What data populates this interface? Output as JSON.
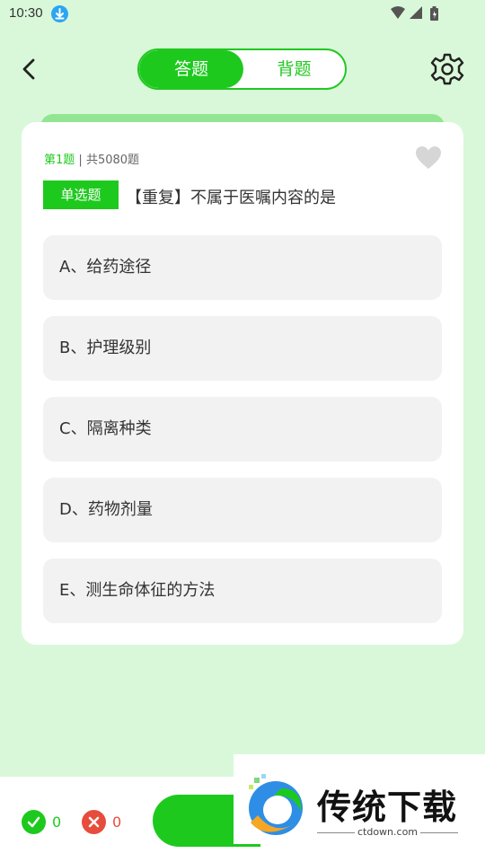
{
  "status_bar": {
    "time": "10:30"
  },
  "header": {
    "tabs": [
      {
        "label": "答题",
        "active": true
      },
      {
        "label": "背题",
        "active": false
      }
    ]
  },
  "question": {
    "index_label": "第1题",
    "separator": " | ",
    "total_label": "共5080题",
    "type": "单选题",
    "text": "【重复】不属于医嘱内容的是",
    "options": [
      "A、给药途径",
      "B、护理级别",
      "C、隔离种类",
      "D、药物剂量",
      "E、测生命体征的方法"
    ]
  },
  "bottom": {
    "correct_count": "0",
    "wrong_count": "0"
  },
  "watermark": {
    "text": "传统下载",
    "url": "ctdown.com"
  },
  "colors": {
    "accent": "#1ec91e",
    "background": "#d9f8d9",
    "wrong": "#e74c3c"
  }
}
